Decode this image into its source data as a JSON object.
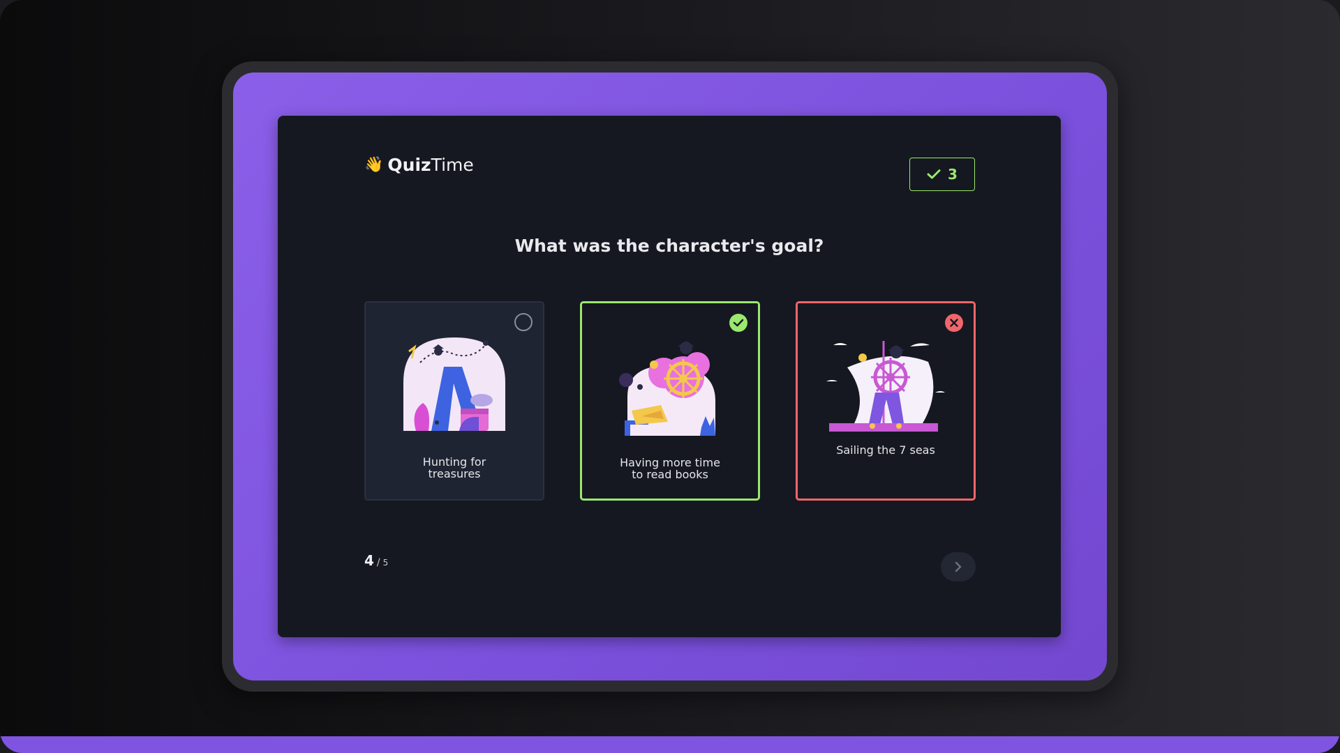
{
  "app": {
    "logo_emoji": "👋",
    "logo_strong": "Quiz",
    "logo_light": "Time"
  },
  "score": {
    "icon": "check-icon",
    "value": "3",
    "color": "#9be86e"
  },
  "question": "What was the character's goal?",
  "options": [
    {
      "label_line1": "Hunting for",
      "label_line2": "treasures",
      "state": "unselected",
      "icon": "empty-circle-icon"
    },
    {
      "label_line1": "Having more time",
      "label_line2": "to read books",
      "state": "correct",
      "icon": "check-circle-icon"
    },
    {
      "label_line1": "Sailing the 7 seas",
      "label_line2": "",
      "state": "wrong",
      "icon": "cross-circle-icon"
    }
  ],
  "progress": {
    "current": "4",
    "separator": "/",
    "total": "5"
  },
  "navigation": {
    "next_icon": "chevron-right-icon"
  },
  "colors": {
    "accent_purple": "#8b5fe8",
    "correct": "#9be86e",
    "wrong": "#f0666a",
    "panel": "#151821"
  }
}
